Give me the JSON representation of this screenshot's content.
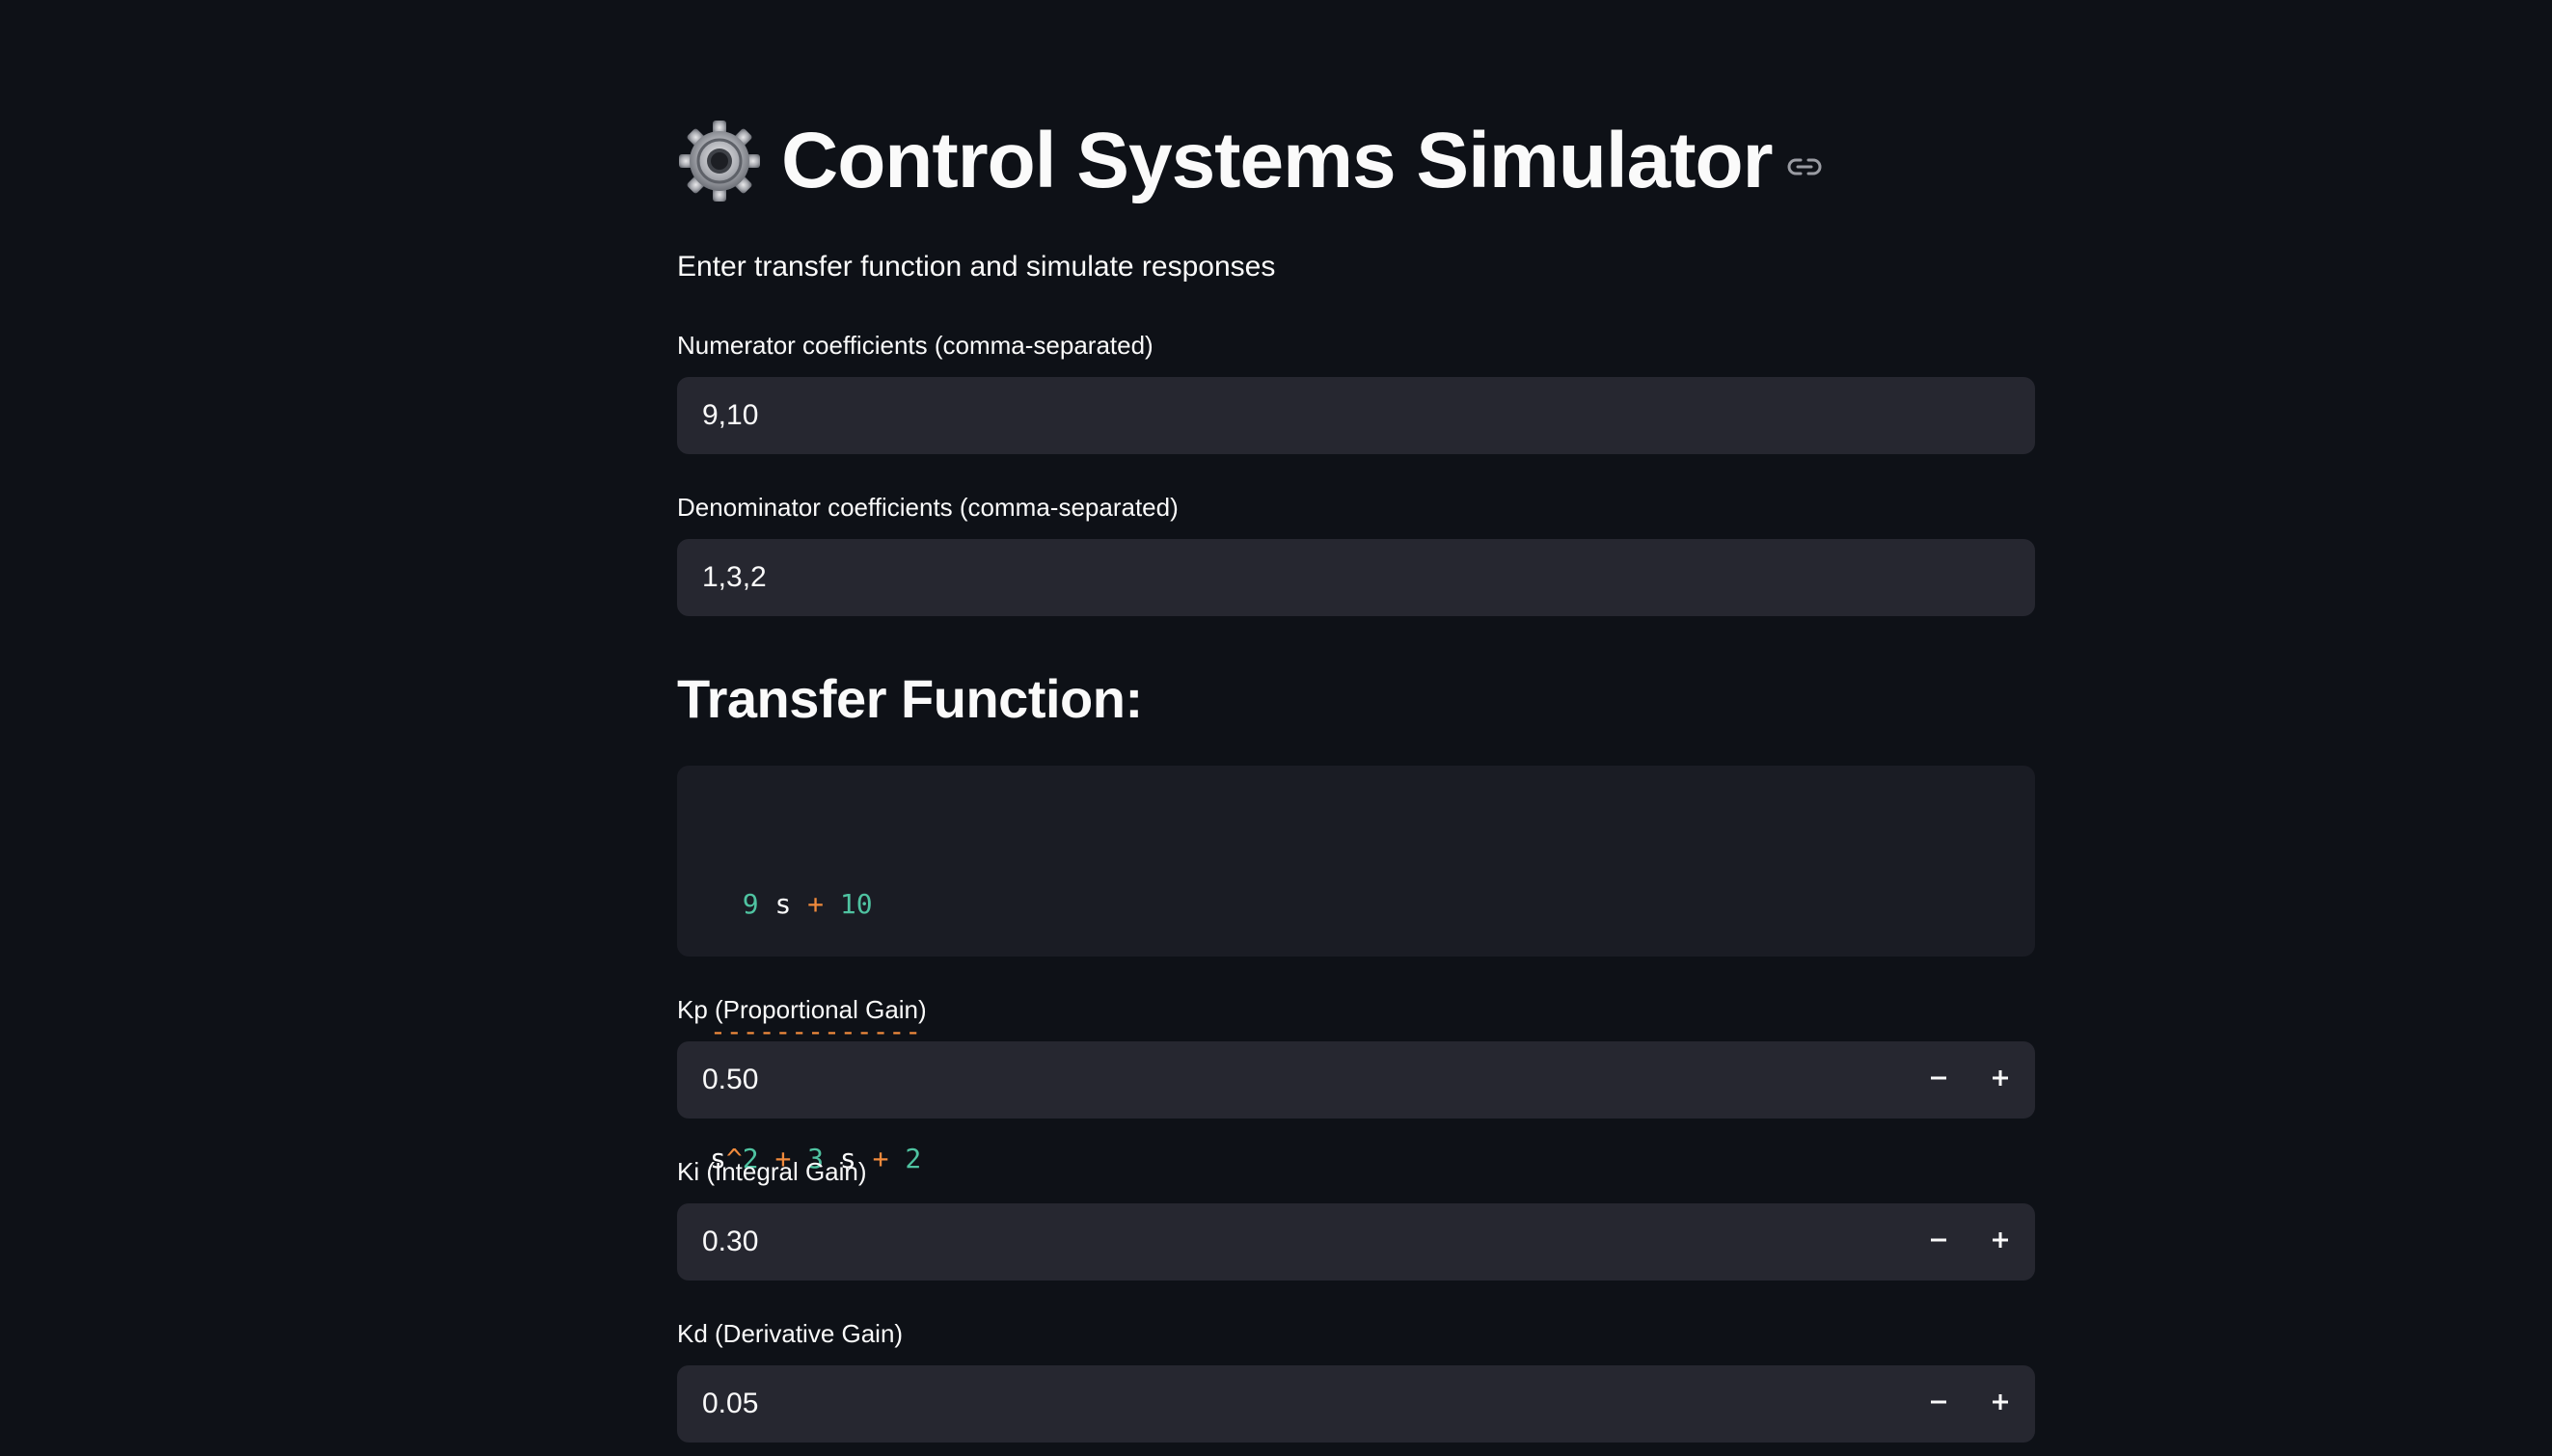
{
  "header": {
    "title": "Control Systems Simulator",
    "subtitle": "Enter transfer function and simulate responses"
  },
  "numerator": {
    "label": "Numerator coefficients (comma-separated)",
    "value": "9,10"
  },
  "denominator": {
    "label": "Denominator coefficients (comma-separated)",
    "value": "1,3,2"
  },
  "transfer_function": {
    "heading": "Transfer Function:",
    "line1": [
      "  ",
      "9",
      " ",
      "s",
      " ",
      "+",
      " ",
      "10"
    ],
    "line2": "-------------",
    "line3": [
      "s",
      "^",
      "2",
      " ",
      "+",
      " ",
      "3",
      " ",
      "s",
      " ",
      "+",
      " ",
      "2"
    ]
  },
  "kp": {
    "label": "Kp (Proportional Gain)",
    "value": "0.50"
  },
  "ki": {
    "label": "Ki (Integral Gain)",
    "value": "0.30"
  },
  "kd": {
    "label": "Kd (Derivative Gain)",
    "value": "0.05"
  },
  "icons": {
    "title_icon": "gear-icon",
    "anchor_icon": "link-icon",
    "minus": "minus-icon",
    "plus": "plus-icon"
  },
  "colors": {
    "background": "#0e1117",
    "input_bg": "#262730",
    "code_bg": "#1a1c24",
    "code_number": "#4fc3a1",
    "code_operator": "#f08a3c"
  }
}
